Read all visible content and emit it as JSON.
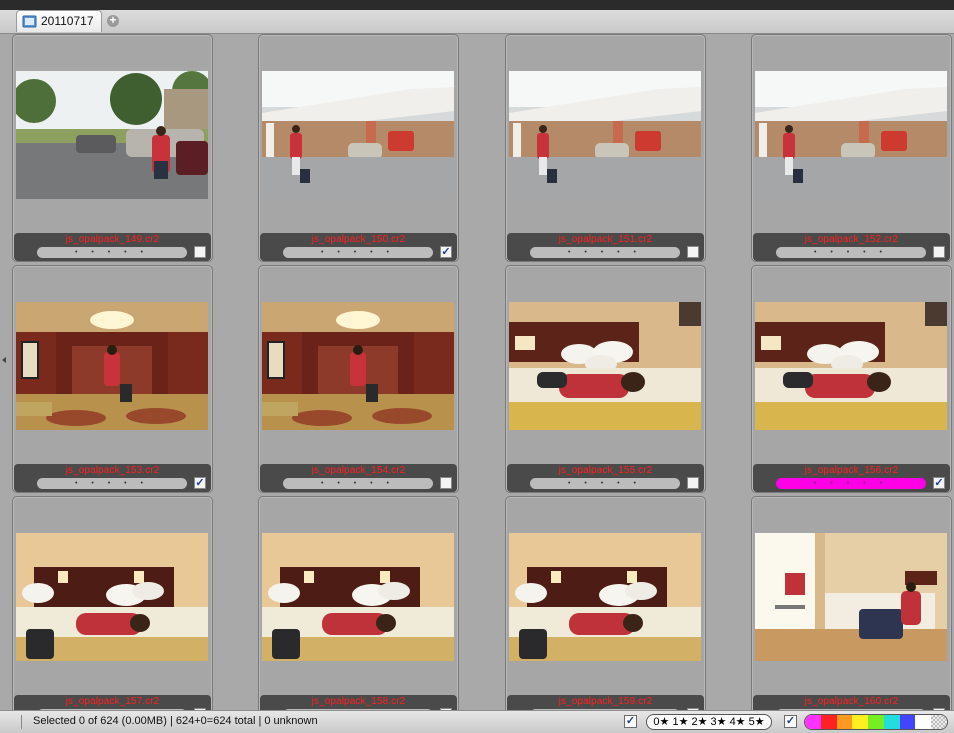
{
  "tab": {
    "label": "20110717"
  },
  "colors": {
    "filename": "#ff2020",
    "label_magenta": "#ff00e6"
  },
  "thumbnails": [
    {
      "filename": "js_opalpack_149.cr2",
      "rating": "• • • • •",
      "checked": false,
      "label": "none",
      "scene": "parking"
    },
    {
      "filename": "js_opalpack_150.cr2",
      "rating": "• • • • •",
      "checked": true,
      "label": "none",
      "scene": "hotel-entrance"
    },
    {
      "filename": "js_opalpack_151.cr2",
      "rating": "• • • • •",
      "checked": false,
      "label": "none",
      "scene": "hotel-entrance"
    },
    {
      "filename": "js_opalpack_152.cr2",
      "rating": "• • • • •",
      "checked": false,
      "label": "none",
      "scene": "hotel-entrance"
    },
    {
      "filename": "js_opalpack_153.cr2",
      "rating": "• • • • •",
      "checked": true,
      "label": "none",
      "scene": "hallway"
    },
    {
      "filename": "js_opalpack_154.cr2",
      "rating": "• • • • •",
      "checked": false,
      "label": "none",
      "scene": "hallway"
    },
    {
      "filename": "js_opalpack_155.cr2",
      "rating": "• • • • •",
      "checked": false,
      "label": "none",
      "scene": "bed"
    },
    {
      "filename": "js_opalpack_156.cr2",
      "rating": "• • • • •",
      "checked": true,
      "label": "magenta",
      "scene": "bed"
    },
    {
      "filename": "js_opalpack_157.cr2",
      "rating": "• • • • •",
      "checked": false,
      "label": "none",
      "scene": "bed-wide"
    },
    {
      "filename": "js_opalpack_158.cr2",
      "rating": "• • • • •",
      "checked": false,
      "label": "none",
      "scene": "bed-wide"
    },
    {
      "filename": "js_opalpack_159.cr2",
      "rating": "• • • • •",
      "checked": false,
      "label": "none",
      "scene": "bed-wide"
    },
    {
      "filename": "js_opalpack_160.cr2",
      "rating": "• • • • •",
      "checked": false,
      "label": "none",
      "scene": "room-window"
    }
  ],
  "status": {
    "text": "Selected 0 of 624 (0.00MB) | 624+0=624 total | 0 unknown",
    "star_filter": "0★ 1★ 2★ 3★ 4★ 5★",
    "star_check": true,
    "color_check": true,
    "color_filter": [
      "#ff33ff",
      "#ff2222",
      "#ff9922",
      "#ffee22",
      "#77ee22",
      "#22dddd",
      "#4444ff",
      "#ffffff",
      "none"
    ]
  }
}
